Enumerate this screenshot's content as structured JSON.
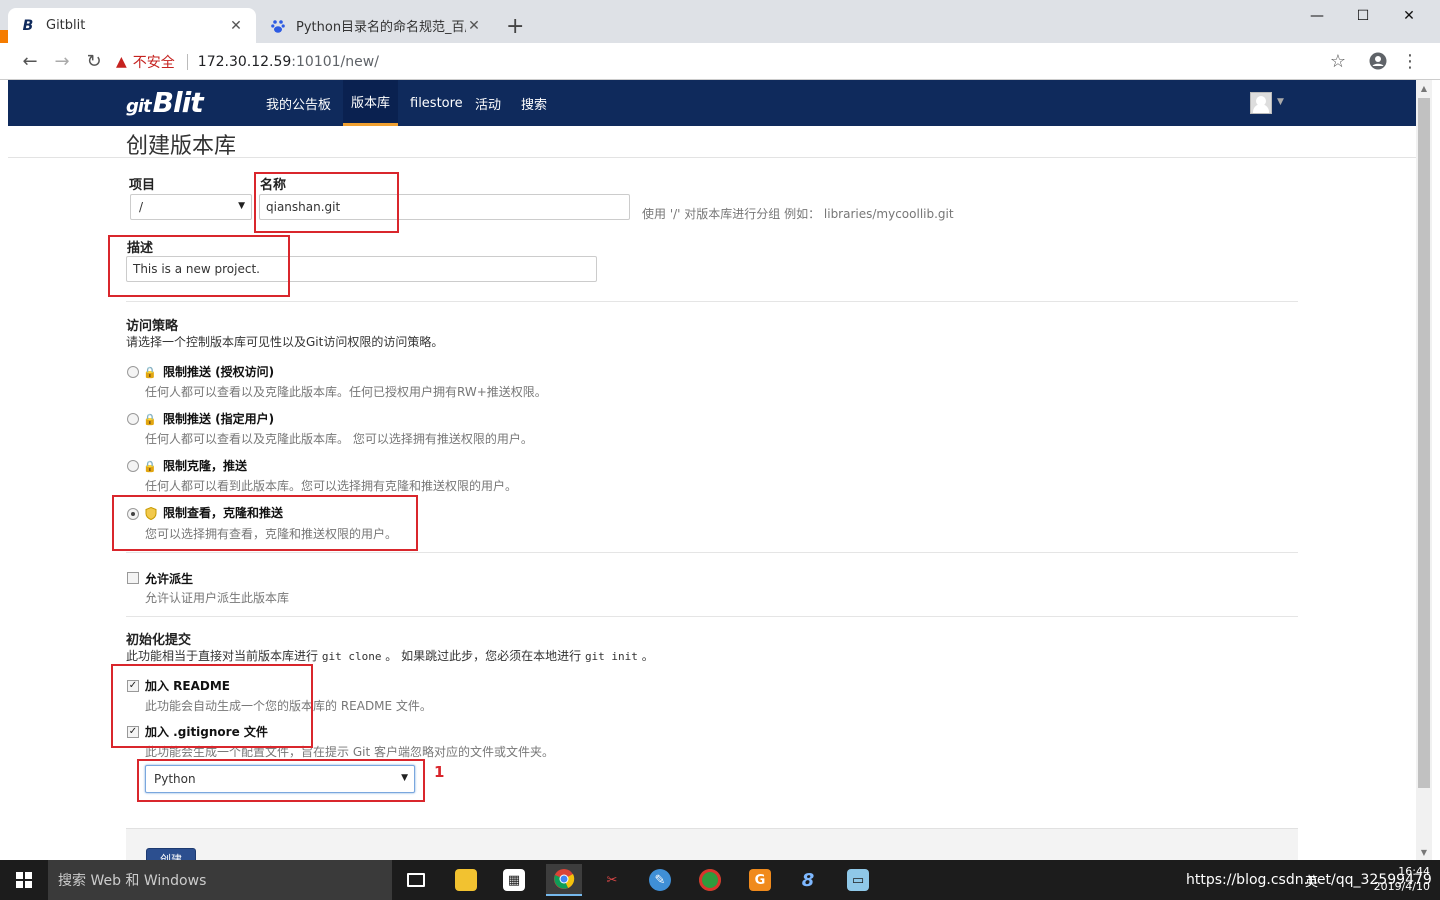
{
  "browser": {
    "tabs": [
      {
        "title": "Gitblit",
        "favicon": "B",
        "active": true
      },
      {
        "title": "Python目录名的命名规范_百度搜",
        "favicon": "baidu-paw",
        "active": false
      }
    ],
    "new_tab": "+",
    "window_controls": {
      "minimize": "—",
      "maximize": "☐",
      "close": "✕"
    },
    "address": {
      "security_label": "不安全",
      "host": "172.30.12.59",
      "path": ":10101/new/"
    }
  },
  "app": {
    "logo_prefix": "git",
    "logo": "Blit",
    "nav": [
      {
        "label": "我的公告板",
        "active": false
      },
      {
        "label": "版本库",
        "active": true
      },
      {
        "label": "filestore",
        "active": false
      },
      {
        "label": "活动",
        "active": false
      },
      {
        "label": "搜索",
        "active": false
      }
    ]
  },
  "page": {
    "title": "创建版本库",
    "project": {
      "label": "项目",
      "value": "/"
    },
    "name": {
      "label": "名称",
      "value": "qianshan.git",
      "help": "使用 '/' 对版本库进行分组 例如： libraries/mycoollib.git"
    },
    "description": {
      "label": "描述",
      "value": "This is a new project."
    },
    "access": {
      "label": "访问策略",
      "help": "请选择一个控制版本库可见性以及Git访问权限的访问策略。",
      "options": [
        {
          "label": "限制推送 (授权访问)",
          "desc": "任何人都可以查看以及克隆此版本库。任何已授权用户拥有RW+推送权限。",
          "selected": false
        },
        {
          "label": "限制推送 (指定用户)",
          "desc": "任何人都可以查看以及克隆此版本库。 您可以选择拥有推送权限的用户。",
          "selected": false
        },
        {
          "label": "限制克隆，推送",
          "desc": "任何人都可以看到此版本库。您可以选择拥有克隆和推送权限的用户。",
          "selected": false
        },
        {
          "label": "限制查看，克隆和推送",
          "desc": "您可以选择拥有查看，克隆和推送权限的用户。",
          "selected": true
        }
      ]
    },
    "allow_fork": {
      "label": "允许派生",
      "desc": "允许认证用户派生此版本库",
      "checked": false
    },
    "init": {
      "label": "初始化提交",
      "help_pre": "此功能相当于直接对当前版本库进行",
      "help_code1": "git clone",
      "help_mid": "。 如果跳过此步，您必须在本地进行",
      "help_code2": "git init",
      "help_post": "。",
      "readme": {
        "label": "加入 README",
        "desc": "此功能会自动生成一个您的版本库的 README 文件。",
        "checked": true
      },
      "gitignore": {
        "label": "加入 .gitignore 文件",
        "desc": "此功能会生成一个配置文件，旨在提示 Git 客户端忽略对应的文件或文件夹。",
        "checked": true,
        "template": "Python"
      }
    },
    "annotation_1": "1",
    "create_button": "创建"
  },
  "taskbar": {
    "search_placeholder": "搜索 Web 和 Windows",
    "tray_text": "https://blog.csdn.net/qq_32599479",
    "tray_lang": "英",
    "time": "16:44",
    "date": "2019/4/10"
  }
}
